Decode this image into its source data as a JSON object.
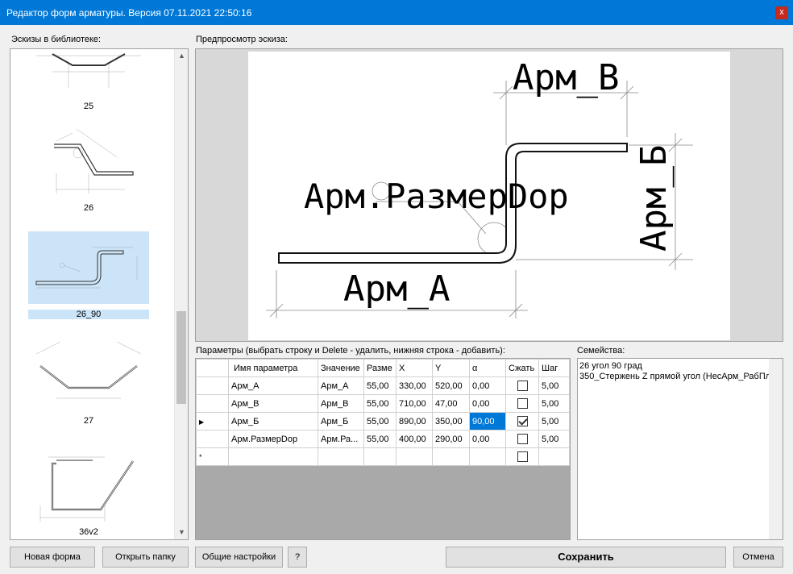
{
  "window": {
    "title": "Редактор форм арматуры. Версия 07.11.2021 22:50:16",
    "close_label": "x"
  },
  "library": {
    "label": "Эскизы в библиотеке:",
    "items": [
      {
        "name": "25",
        "selected": false
      },
      {
        "name": "26",
        "selected": false
      },
      {
        "name": "26_90",
        "selected": true
      },
      {
        "name": "27",
        "selected": false
      },
      {
        "name": "36v2",
        "selected": false
      }
    ]
  },
  "preview": {
    "label": "Предпросмотр эскиза:",
    "dims": {
      "a": "Арм_А",
      "b": "Арм_В",
      "c": "Арм_Б",
      "d": "Арм.РазмерDop"
    }
  },
  "params": {
    "label": "Параметры (выбрать строку и Delete - удалить, нижняя строка - добавить):",
    "columns": [
      "Имя параметра",
      "Значение",
      "Разме",
      "X",
      "Y",
      "α",
      "Сжать",
      "Шаг"
    ],
    "rows": [
      {
        "name": "Арм_А",
        "value": "Арм_А",
        "size": "55,00",
        "x": "330,00",
        "y": "520,00",
        "alpha": "0,00",
        "compress": false,
        "step": "5,00",
        "current": false
      },
      {
        "name": "Арм_В",
        "value": "Арм_В",
        "size": "55,00",
        "x": "710,00",
        "y": "47,00",
        "alpha": "0,00",
        "compress": false,
        "step": "5,00",
        "current": false
      },
      {
        "name": "Арм_Б",
        "value": "Арм_Б",
        "size": "55,00",
        "x": "890,00",
        "y": "350,00",
        "alpha": "90,00",
        "compress": true,
        "step": "5,00",
        "current": true
      },
      {
        "name": "Арм.РазмерDop",
        "value": "Арм.Ра...",
        "size": "55,00",
        "x": "400,00",
        "y": "290,00",
        "alpha": "0,00",
        "compress": false,
        "step": "5,00",
        "current": false
      }
    ],
    "new_row_marker": "*"
  },
  "families": {
    "label": "Семейства:",
    "items": [
      "26 угол 90 град",
      "350_Стержень Z прямой угол (НесАрм_РабПл"
    ]
  },
  "buttons": {
    "new_form": "Новая форма",
    "open_folder": "Открыть папку",
    "general_settings": "Общие настройки",
    "help": "?",
    "save": "Сохранить",
    "cancel": "Отмена"
  }
}
